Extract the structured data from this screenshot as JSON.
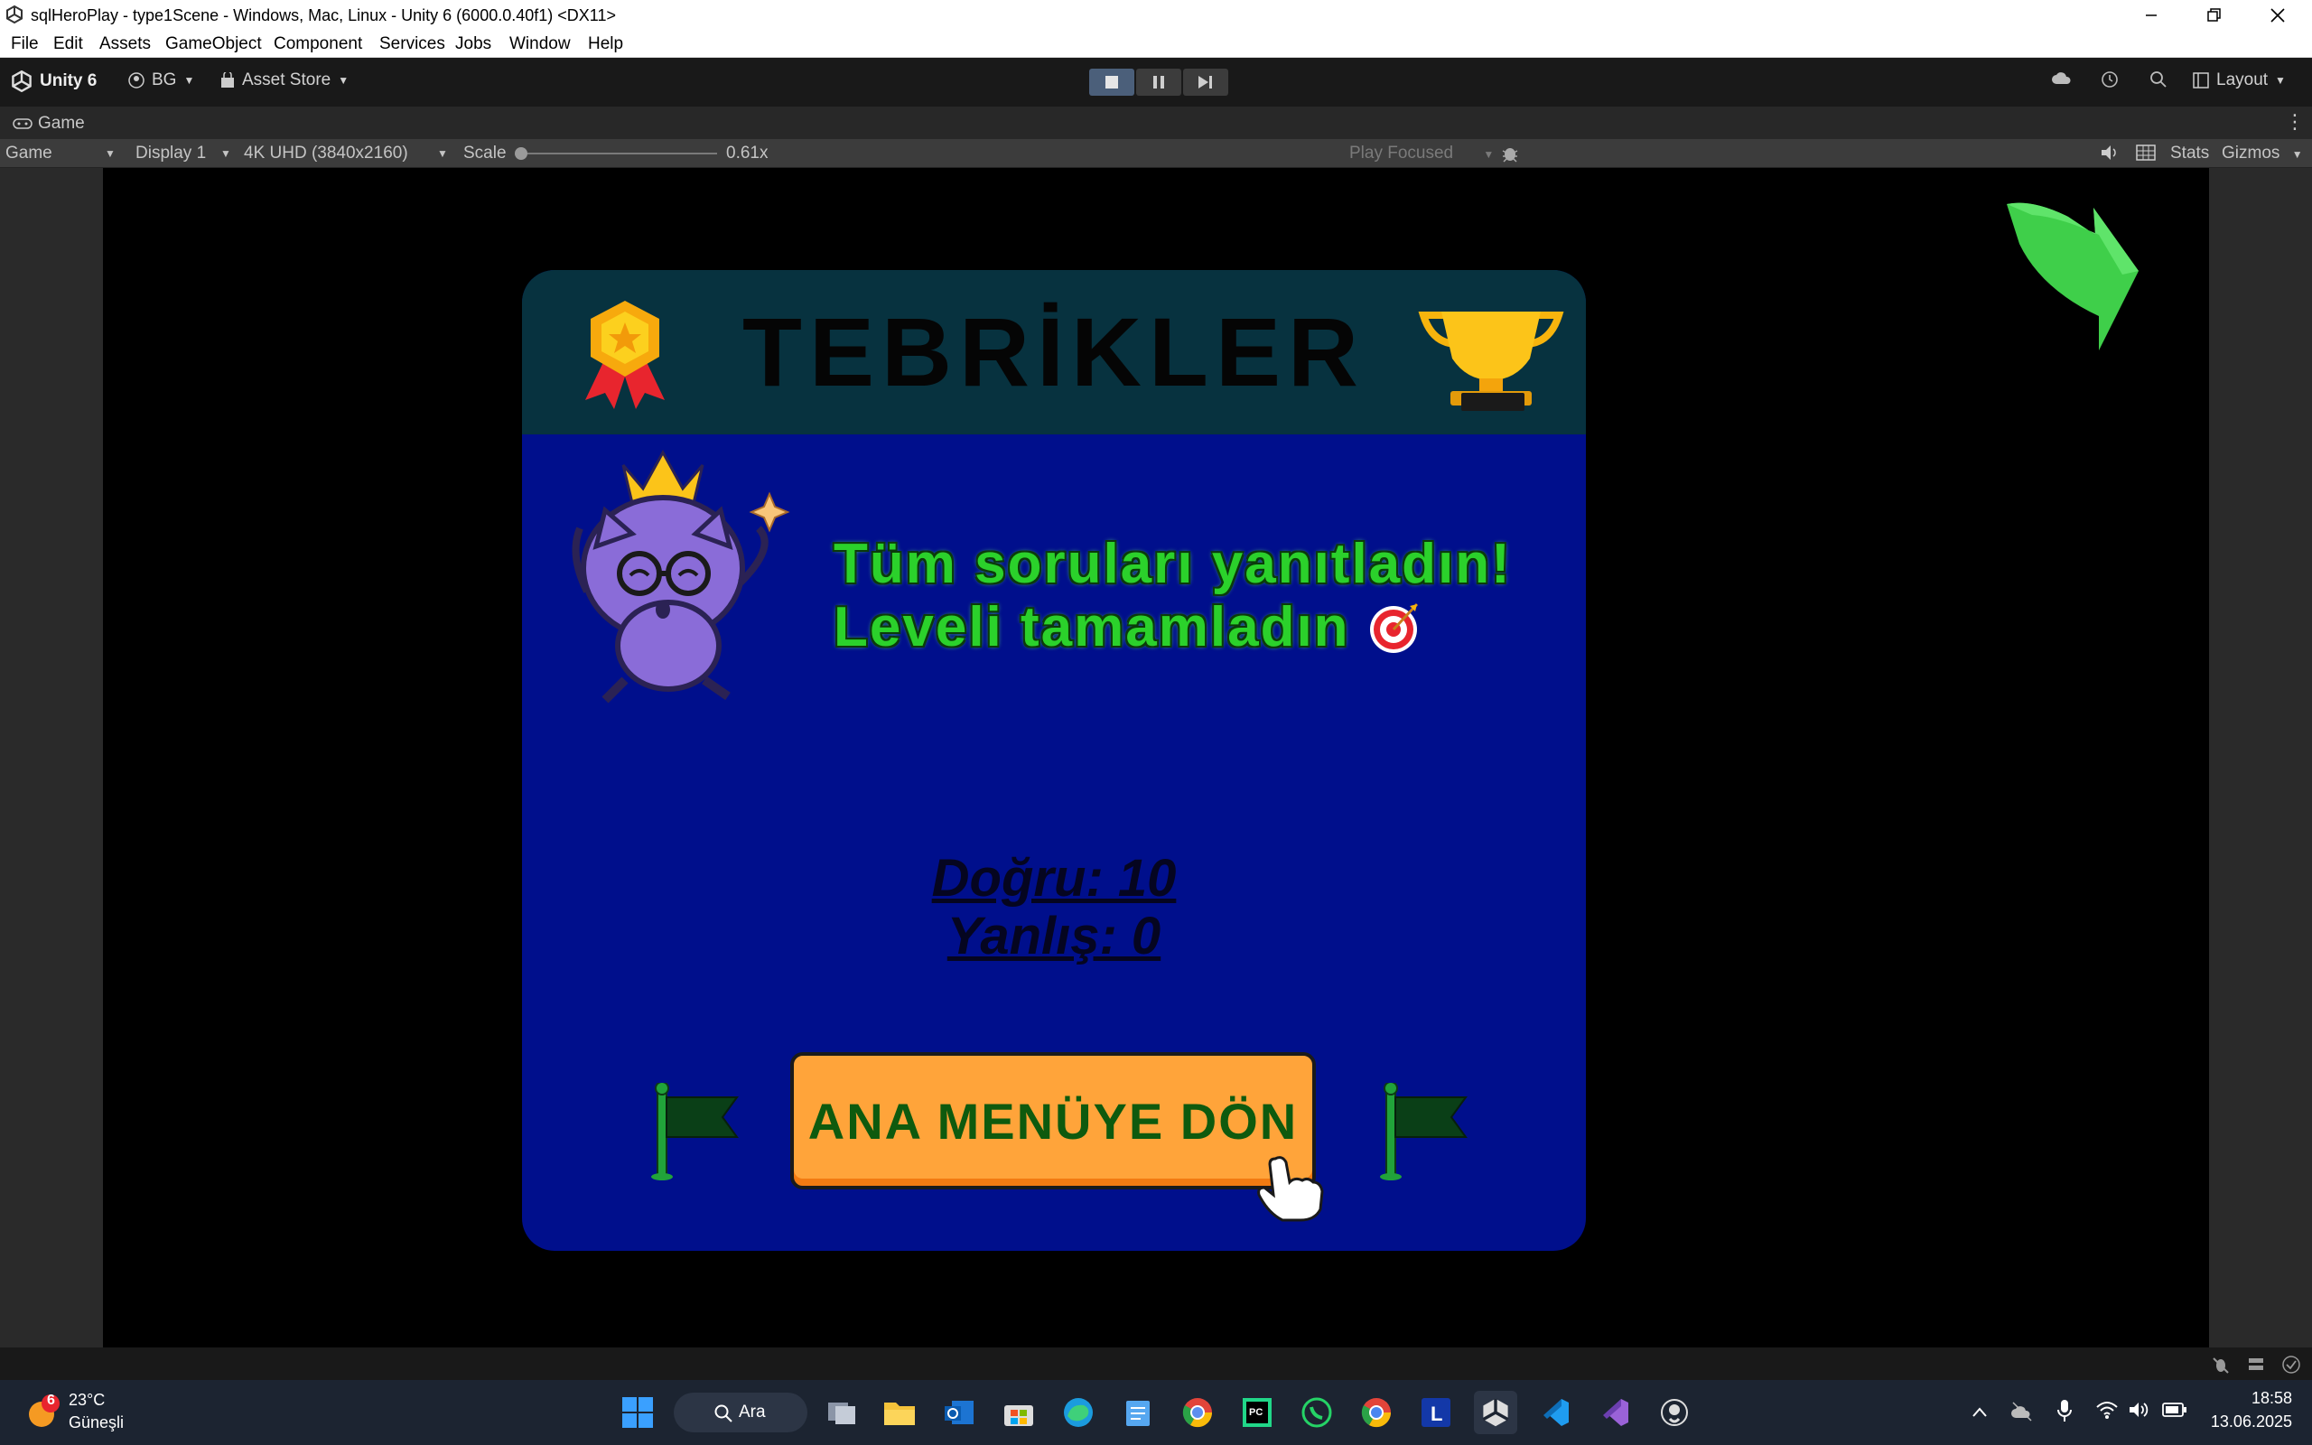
{
  "window": {
    "title": "sqlHeroPlay - type1Scene - Windows, Mac, Linux - Unity 6 (6000.0.40f1) <DX11>"
  },
  "menu": [
    "File",
    "Edit",
    "Assets",
    "GameObject",
    "Component",
    "Services",
    "Jobs",
    "Window",
    "Help"
  ],
  "toolbar": {
    "unity_label": "Unity 6",
    "account": "BG",
    "asset_store": "Asset Store",
    "layout": "Layout"
  },
  "game_tab": {
    "label": "Game"
  },
  "game_toolbar": {
    "view_mode": "Game",
    "display": "Display 1",
    "resolution": "4K UHD (3840x2160)",
    "scale_label": "Scale",
    "scale_value": "0.61x",
    "scale_fraction": 0.0,
    "play_focused": "Play Focused",
    "stats": "Stats",
    "gizmos": "Gizmos"
  },
  "game": {
    "heading": "TEBRİKLER",
    "message_line1": "Tüm soruları yanıtladın!",
    "message_line2": "Leveli tamamladın",
    "correct": "Doğru: 10",
    "wrong": "Yanlış: 0",
    "button": "ANA MENÜYE DÖN",
    "colors": {
      "panel": "#000f8c",
      "header": "#07323f",
      "message": "#2bd12b",
      "button": "#ffa43a"
    }
  },
  "taskbar": {
    "weather_temp": "23°C",
    "weather_desc": "Güneşli",
    "weather_badge": "6",
    "search": "Ara",
    "time": "18:58",
    "date": "13.06.2025",
    "apps": [
      "windows-start-icon",
      "search-icon",
      "task-view-icon",
      "file-explorer-icon",
      "outlook-icon",
      "ms-store-icon",
      "edge-icon",
      "notepad-icon",
      "chrome-dev-icon",
      "pycharm-icon",
      "whatsapp-icon",
      "chrome-icon",
      "l-app-icon",
      "unity-icon",
      "vscode-icon",
      "visual-studio-icon",
      "github-icon"
    ]
  }
}
